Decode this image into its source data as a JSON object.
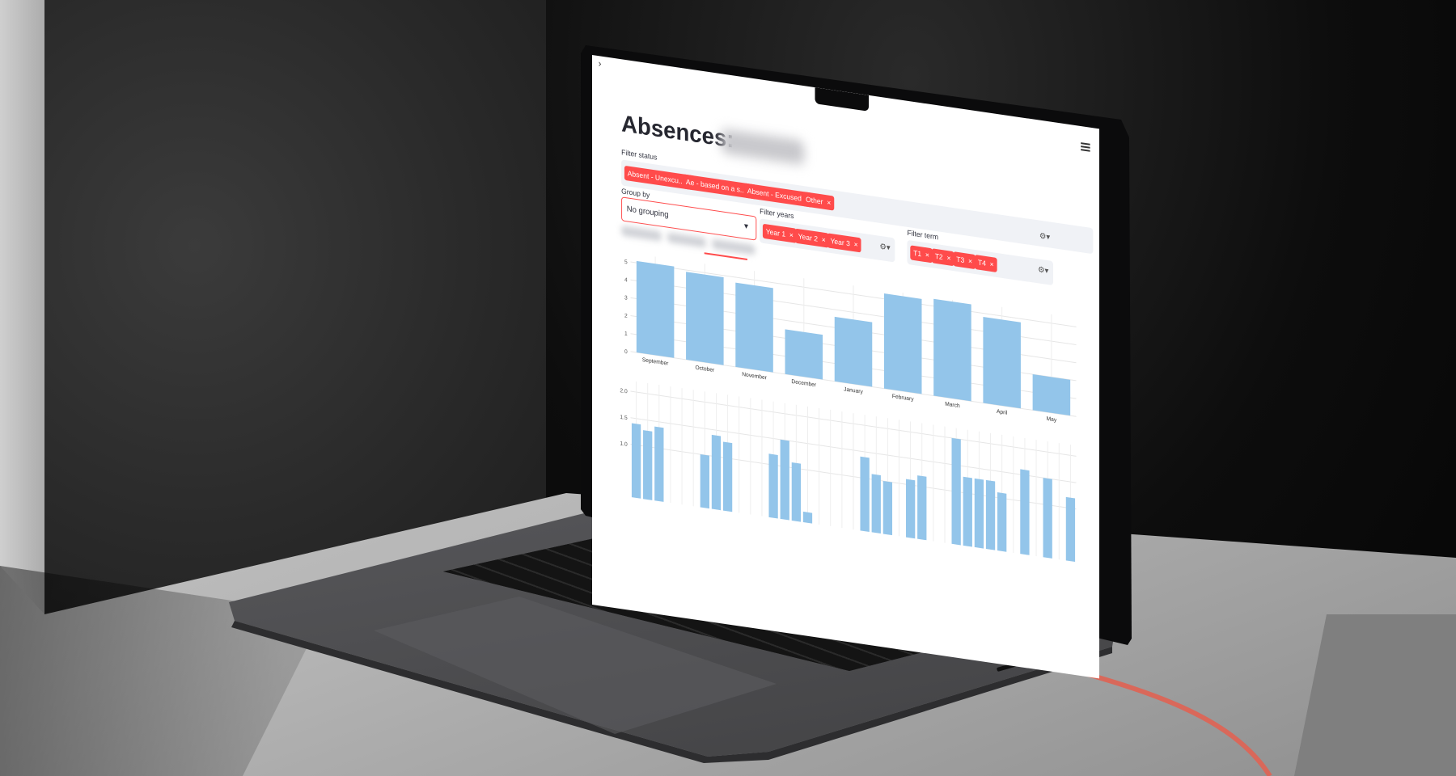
{
  "sidebar": {
    "toggle_icon": "chevron-right-icon"
  },
  "header": {
    "menu_icon": "hamburger-menu-icon"
  },
  "page": {
    "title": "Absences:"
  },
  "filters": {
    "status": {
      "label": "Filter status",
      "tags": [
        "Absent - Unexcu...",
        "Ae - based on a s...",
        "Absent - Excused",
        "Other"
      ]
    },
    "group_by": {
      "label": "Group by",
      "value": "No grouping"
    },
    "years": {
      "label": "Filter years",
      "tags": [
        "Year 1",
        "Year 2",
        "Year 3"
      ]
    },
    "term": {
      "label": "Filter term",
      "tags": [
        "T1",
        "T2",
        "T3",
        "T4"
      ]
    }
  },
  "colors": {
    "accent": "#ff4b4b",
    "bar": "#93c5ea",
    "tag_bg": "#ff4b4b",
    "field_bg": "#f0f2f6"
  },
  "chart_data": [
    {
      "type": "bar",
      "categories": [
        "September",
        "October",
        "November",
        "December",
        "January",
        "February",
        "March",
        "April",
        "May"
      ],
      "values": [
        5.1,
        4.9,
        4.7,
        2.5,
        3.6,
        5.3,
        5.4,
        4.8,
        2.0
      ],
      "yticks": [
        "0",
        "1",
        "2",
        "3",
        "4",
        "5"
      ],
      "ylim": [
        0,
        5.5
      ],
      "grid": true
    },
    {
      "type": "bar",
      "values": [
        1.4,
        1.3,
        1.4,
        0,
        0,
        0,
        1.0,
        1.4,
        1.3,
        0,
        0,
        0,
        1.2,
        1.5,
        1.1,
        0.2,
        0,
        0,
        0,
        0,
        1.4,
        1.1,
        1.0,
        0,
        1.1,
        1.2,
        0,
        0,
        2.0,
        1.3,
        1.3,
        1.3,
        1.1,
        0,
        1.6,
        0,
        1.5,
        0,
        1.2
      ],
      "yticks": [
        "1.0",
        "1.5",
        "2.0"
      ],
      "ylim": [
        0,
        2.2
      ],
      "grid": true
    }
  ]
}
